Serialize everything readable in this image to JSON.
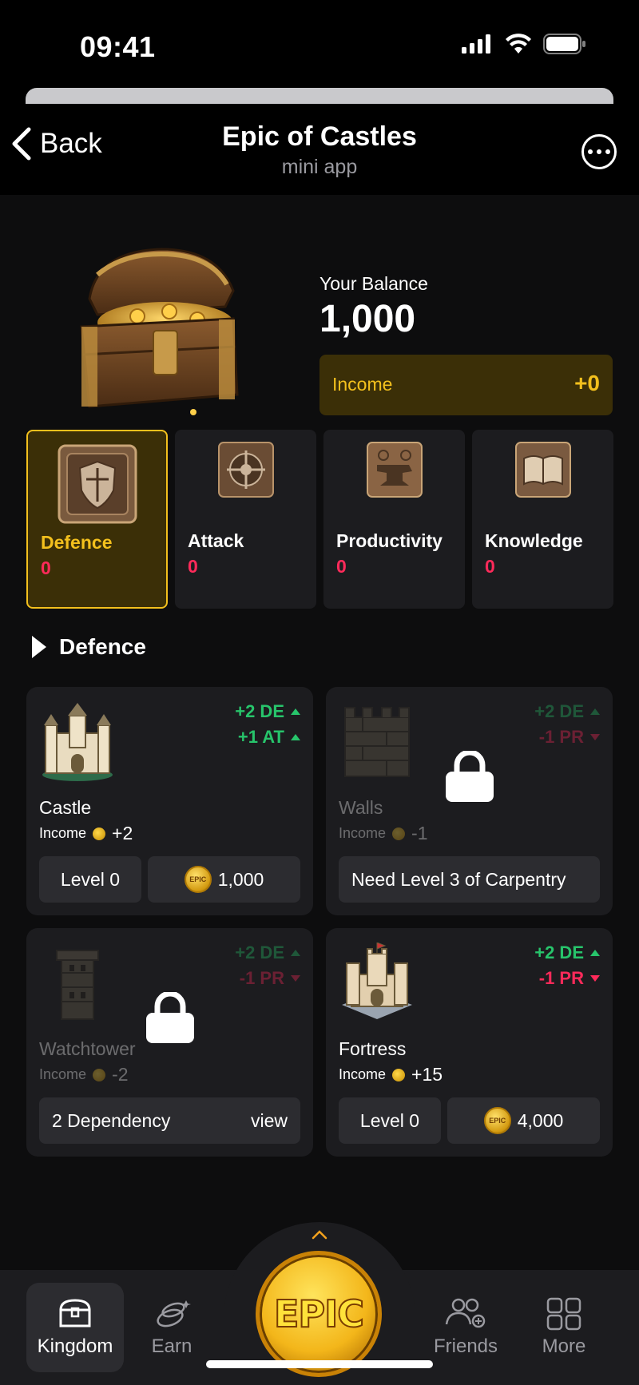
{
  "status": {
    "time": "09:41"
  },
  "header": {
    "back_label": "Back",
    "title": "Epic of Castles",
    "subtitle": "mini app"
  },
  "balance": {
    "label": "Your Balance",
    "value": "1,000",
    "income_label": "Income",
    "income_value": "+0"
  },
  "categories": [
    {
      "name": "Defence",
      "count": "0",
      "active": true,
      "icon": "shield-tile-icon"
    },
    {
      "name": "Attack",
      "count": "0",
      "active": false,
      "icon": "crosshair-tile-icon"
    },
    {
      "name": "Productivity",
      "count": "0",
      "active": false,
      "icon": "anvil-tile-icon"
    },
    {
      "name": "Knowledge",
      "count": "0",
      "active": false,
      "icon": "book-tile-icon"
    }
  ],
  "section": {
    "title": "Defence"
  },
  "buildings": [
    {
      "name": "Castle",
      "locked": false,
      "stat1": "+2 DE",
      "stat1_dir": "up",
      "stat2": "+1 AT",
      "stat2_dir": "up",
      "income_label": "Income",
      "income": "+2",
      "level": "Level 0",
      "cost": "1,000"
    },
    {
      "name": "Walls",
      "locked": true,
      "stat1": "+2 DE",
      "stat1_dir": "up",
      "stat2": "-1 PR",
      "stat2_dir": "down",
      "income_label": "Income",
      "income": "-1",
      "requirement": "Need Level 3 of Carpentry"
    },
    {
      "name": "Watchtower",
      "locked": true,
      "stat1": "+2 DE",
      "stat1_dir": "up",
      "stat2": "-1 PR",
      "stat2_dir": "down",
      "income_label": "Income",
      "income": "-2",
      "dependency": "2 Dependency",
      "dependency_link": "view"
    },
    {
      "name": "Fortress",
      "locked": false,
      "stat1": "+2 DE",
      "stat1_dir": "up",
      "stat2": "-1 PR",
      "stat2_dir": "down",
      "income_label": "Income",
      "income": "+15",
      "level": "Level 0",
      "cost": "4,000"
    }
  ],
  "coin_label": "EPIC",
  "nav": {
    "items": [
      {
        "label": "Kingdom",
        "icon": "chest-icon",
        "active": true
      },
      {
        "label": "Earn",
        "icon": "coins-icon",
        "active": false
      },
      {
        "label": "Friends",
        "icon": "friends-icon",
        "active": false
      },
      {
        "label": "More",
        "icon": "grid-icon",
        "active": false
      }
    ],
    "center_label": "EPIC"
  },
  "colors": {
    "accent": "#f3c01d",
    "accent_bg": "#3b2f07",
    "positive": "#27c46b",
    "negative": "#ff2a5a",
    "card_bg": "#1c1c1f"
  }
}
